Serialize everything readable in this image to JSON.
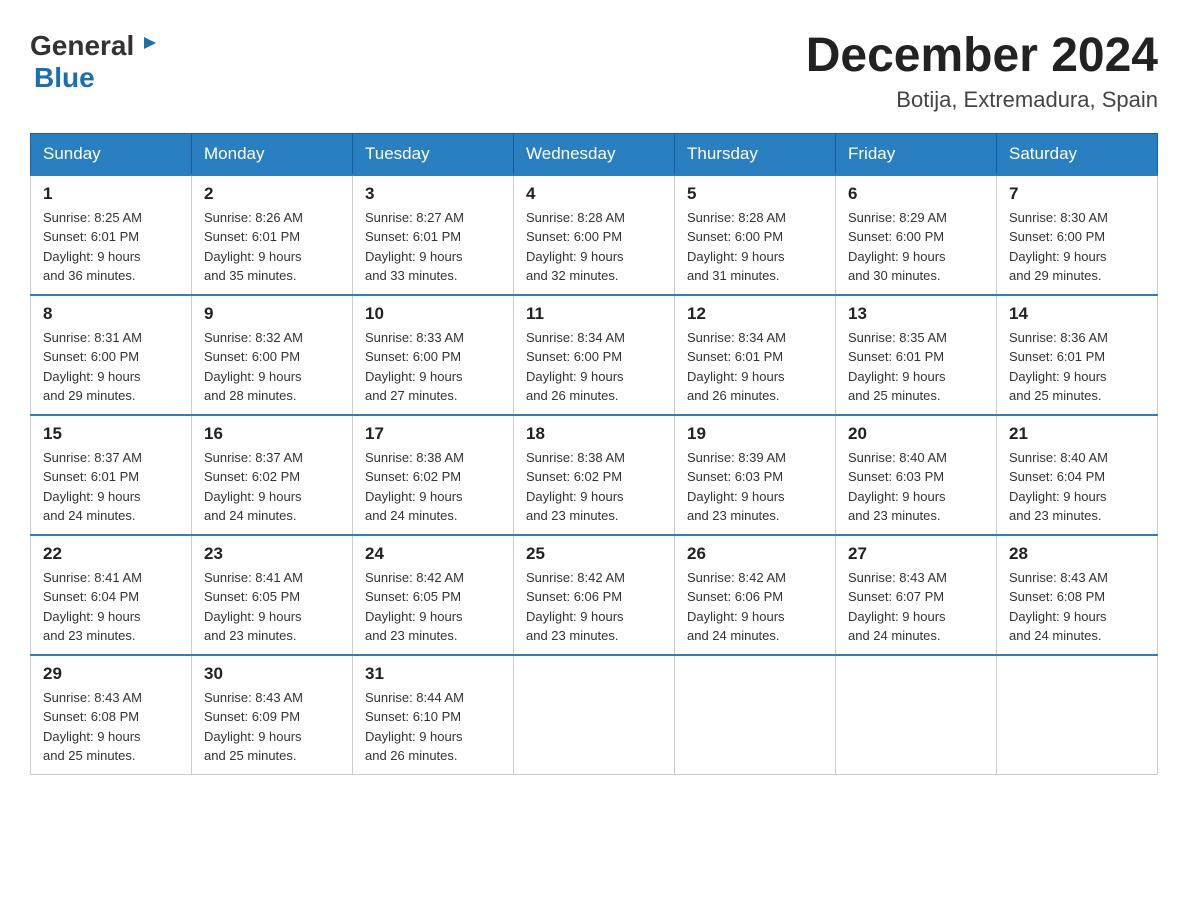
{
  "header": {
    "logo": {
      "general": "General",
      "blue": "Blue",
      "tagline": "GeneralBlue"
    },
    "title": "December 2024",
    "location": "Botija, Extremadura, Spain"
  },
  "weekdays": [
    "Sunday",
    "Monday",
    "Tuesday",
    "Wednesday",
    "Thursday",
    "Friday",
    "Saturday"
  ],
  "weeks": [
    [
      {
        "day": "1",
        "sunrise": "8:25 AM",
        "sunset": "6:01 PM",
        "daylight": "9 hours and 36 minutes."
      },
      {
        "day": "2",
        "sunrise": "8:26 AM",
        "sunset": "6:01 PM",
        "daylight": "9 hours and 35 minutes."
      },
      {
        "day": "3",
        "sunrise": "8:27 AM",
        "sunset": "6:01 PM",
        "daylight": "9 hours and 33 minutes."
      },
      {
        "day": "4",
        "sunrise": "8:28 AM",
        "sunset": "6:00 PM",
        "daylight": "9 hours and 32 minutes."
      },
      {
        "day": "5",
        "sunrise": "8:28 AM",
        "sunset": "6:00 PM",
        "daylight": "9 hours and 31 minutes."
      },
      {
        "day": "6",
        "sunrise": "8:29 AM",
        "sunset": "6:00 PM",
        "daylight": "9 hours and 30 minutes."
      },
      {
        "day": "7",
        "sunrise": "8:30 AM",
        "sunset": "6:00 PM",
        "daylight": "9 hours and 29 minutes."
      }
    ],
    [
      {
        "day": "8",
        "sunrise": "8:31 AM",
        "sunset": "6:00 PM",
        "daylight": "9 hours and 29 minutes."
      },
      {
        "day": "9",
        "sunrise": "8:32 AM",
        "sunset": "6:00 PM",
        "daylight": "9 hours and 28 minutes."
      },
      {
        "day": "10",
        "sunrise": "8:33 AM",
        "sunset": "6:00 PM",
        "daylight": "9 hours and 27 minutes."
      },
      {
        "day": "11",
        "sunrise": "8:34 AM",
        "sunset": "6:00 PM",
        "daylight": "9 hours and 26 minutes."
      },
      {
        "day": "12",
        "sunrise": "8:34 AM",
        "sunset": "6:01 PM",
        "daylight": "9 hours and 26 minutes."
      },
      {
        "day": "13",
        "sunrise": "8:35 AM",
        "sunset": "6:01 PM",
        "daylight": "9 hours and 25 minutes."
      },
      {
        "day": "14",
        "sunrise": "8:36 AM",
        "sunset": "6:01 PM",
        "daylight": "9 hours and 25 minutes."
      }
    ],
    [
      {
        "day": "15",
        "sunrise": "8:37 AM",
        "sunset": "6:01 PM",
        "daylight": "9 hours and 24 minutes."
      },
      {
        "day": "16",
        "sunrise": "8:37 AM",
        "sunset": "6:02 PM",
        "daylight": "9 hours and 24 minutes."
      },
      {
        "day": "17",
        "sunrise": "8:38 AM",
        "sunset": "6:02 PM",
        "daylight": "9 hours and 24 minutes."
      },
      {
        "day": "18",
        "sunrise": "8:38 AM",
        "sunset": "6:02 PM",
        "daylight": "9 hours and 23 minutes."
      },
      {
        "day": "19",
        "sunrise": "8:39 AM",
        "sunset": "6:03 PM",
        "daylight": "9 hours and 23 minutes."
      },
      {
        "day": "20",
        "sunrise": "8:40 AM",
        "sunset": "6:03 PM",
        "daylight": "9 hours and 23 minutes."
      },
      {
        "day": "21",
        "sunrise": "8:40 AM",
        "sunset": "6:04 PM",
        "daylight": "9 hours and 23 minutes."
      }
    ],
    [
      {
        "day": "22",
        "sunrise": "8:41 AM",
        "sunset": "6:04 PM",
        "daylight": "9 hours and 23 minutes."
      },
      {
        "day": "23",
        "sunrise": "8:41 AM",
        "sunset": "6:05 PM",
        "daylight": "9 hours and 23 minutes."
      },
      {
        "day": "24",
        "sunrise": "8:42 AM",
        "sunset": "6:05 PM",
        "daylight": "9 hours and 23 minutes."
      },
      {
        "day": "25",
        "sunrise": "8:42 AM",
        "sunset": "6:06 PM",
        "daylight": "9 hours and 23 minutes."
      },
      {
        "day": "26",
        "sunrise": "8:42 AM",
        "sunset": "6:06 PM",
        "daylight": "9 hours and 24 minutes."
      },
      {
        "day": "27",
        "sunrise": "8:43 AM",
        "sunset": "6:07 PM",
        "daylight": "9 hours and 24 minutes."
      },
      {
        "day": "28",
        "sunrise": "8:43 AM",
        "sunset": "6:08 PM",
        "daylight": "9 hours and 24 minutes."
      }
    ],
    [
      {
        "day": "29",
        "sunrise": "8:43 AM",
        "sunset": "6:08 PM",
        "daylight": "9 hours and 25 minutes."
      },
      {
        "day": "30",
        "sunrise": "8:43 AM",
        "sunset": "6:09 PM",
        "daylight": "9 hours and 25 minutes."
      },
      {
        "day": "31",
        "sunrise": "8:44 AM",
        "sunset": "6:10 PM",
        "daylight": "9 hours and 26 minutes."
      },
      null,
      null,
      null,
      null
    ]
  ],
  "labels": {
    "sunrise": "Sunrise:",
    "sunset": "Sunset:",
    "daylight": "Daylight:"
  }
}
